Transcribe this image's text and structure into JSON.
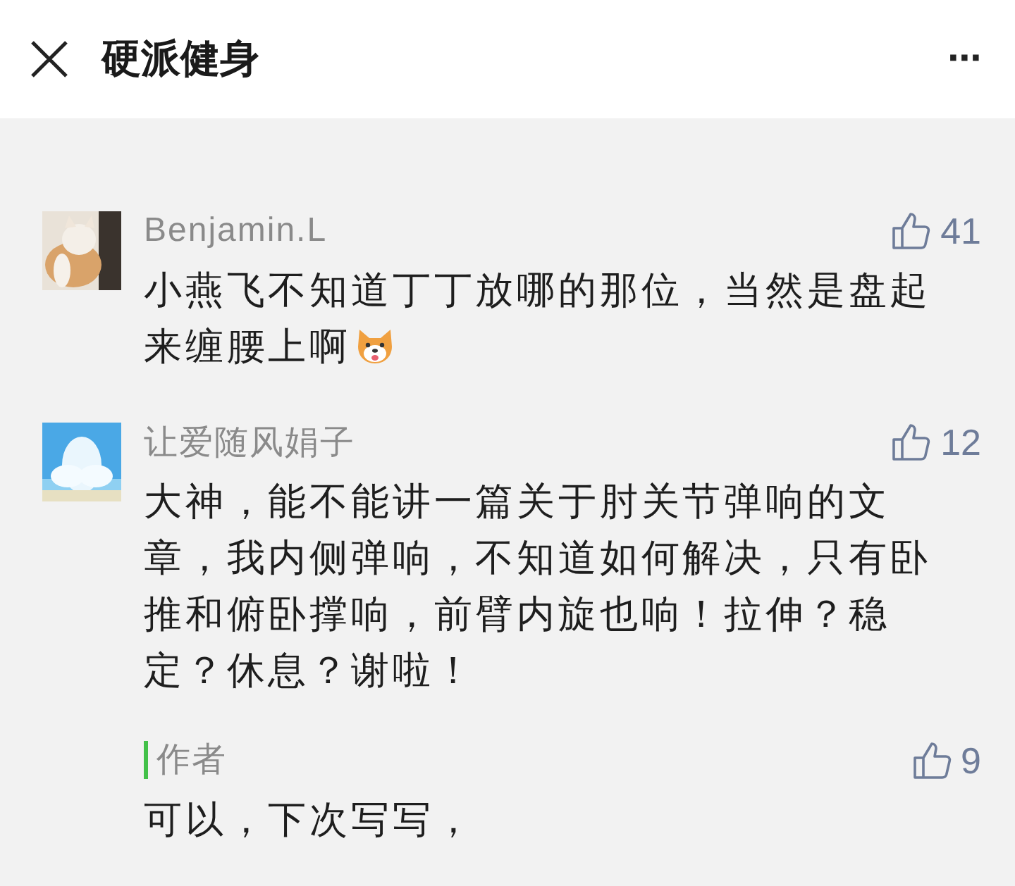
{
  "header": {
    "title": "硬派健身",
    "more": "···"
  },
  "comments": [
    {
      "name": "Benjamin.L",
      "likes": "41",
      "text": "小燕飞不知道丁丁放哪的那位，当然是盘起来缠腰上啊",
      "emoji": true
    },
    {
      "name": "让爱随风娟子",
      "likes": "12",
      "text": "大神，能不能讲一篇关于肘关节弹响的文章，我内侧弹响，不知道如何解决，只有卧推和俯卧撑响，前臂内旋也响！拉伸？稳定？休息？谢啦！",
      "emoji": false,
      "reply": {
        "author": "作者",
        "likes": "9",
        "text": "可以，下次写写，"
      }
    }
  ]
}
